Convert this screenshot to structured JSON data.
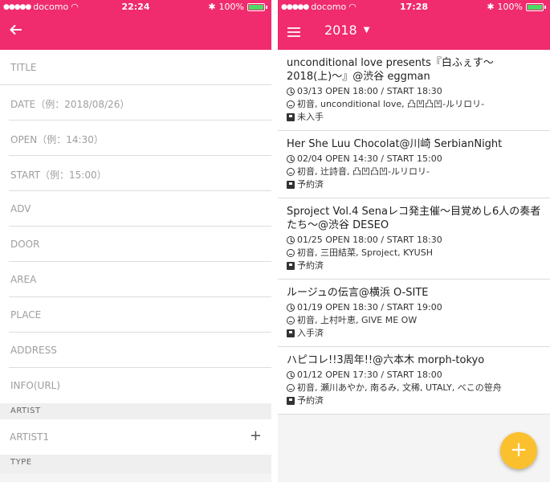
{
  "left": {
    "status": {
      "carrier": "docomo",
      "time": "22:24",
      "battery": "100%"
    },
    "form": {
      "fields": [
        "TITLE",
        "DATE（例：2018/08/26）",
        "OPEN（例：14:30）",
        "START（例：15:00）",
        "ADV",
        "DOOR",
        "AREA",
        "PLACE",
        "ADDRESS",
        "INFO(URL)"
      ],
      "artist_section": "ARTIST",
      "artist_field": "ARTIST1",
      "type_section": "TYPE"
    }
  },
  "right": {
    "status": {
      "carrier": "docomo",
      "time": "17:28",
      "battery": "100%"
    },
    "year": "2018",
    "events": [
      {
        "title": "unconditional love presents『白ふぇす〜2018(上)〜』@渋谷 eggman",
        "time": "03/13 OPEN 18:00 / START 18:30",
        "artists": "初音, unconditional love, 凸凹凸凹-ルリロリ-",
        "ticket": "未入手"
      },
      {
        "title": "Her She Luu Chocolat@川崎 SerbianNight",
        "time": "02/04 OPEN 14:30 / START 15:00",
        "artists": "初音, 辻詩音, 凸凹凸凹-ルリロリ-",
        "ticket": "予約済"
      },
      {
        "title": "Sproject Vol.4 Senaレコ発主催〜目覚めし6人の奏者たち〜@渋谷 DESEO",
        "time": "01/25 OPEN 18:00 / START 18:30",
        "artists": "初音, 三田結菜, Sproject, KYUSH",
        "ticket": "予約済"
      },
      {
        "title": "ルージュの伝言@横浜 O-SITE",
        "time": "01/19 OPEN 18:30 / START 19:00",
        "artists": "初音, 上村叶恵, GIVE ME OW",
        "ticket": "入手済"
      },
      {
        "title": "ハピコレ!!3周年!!@六本木 morph-tokyo",
        "time": "01/12 OPEN 17:30 / START 18:00",
        "artists": "初音, 瀬川あやか, 南るみ, 文稀, UTALY, べこの笹舟",
        "ticket": "予約済"
      }
    ],
    "fab": "+"
  },
  "colors": {
    "appbar": "#f02b6e",
    "fab": "#fbc02d"
  }
}
